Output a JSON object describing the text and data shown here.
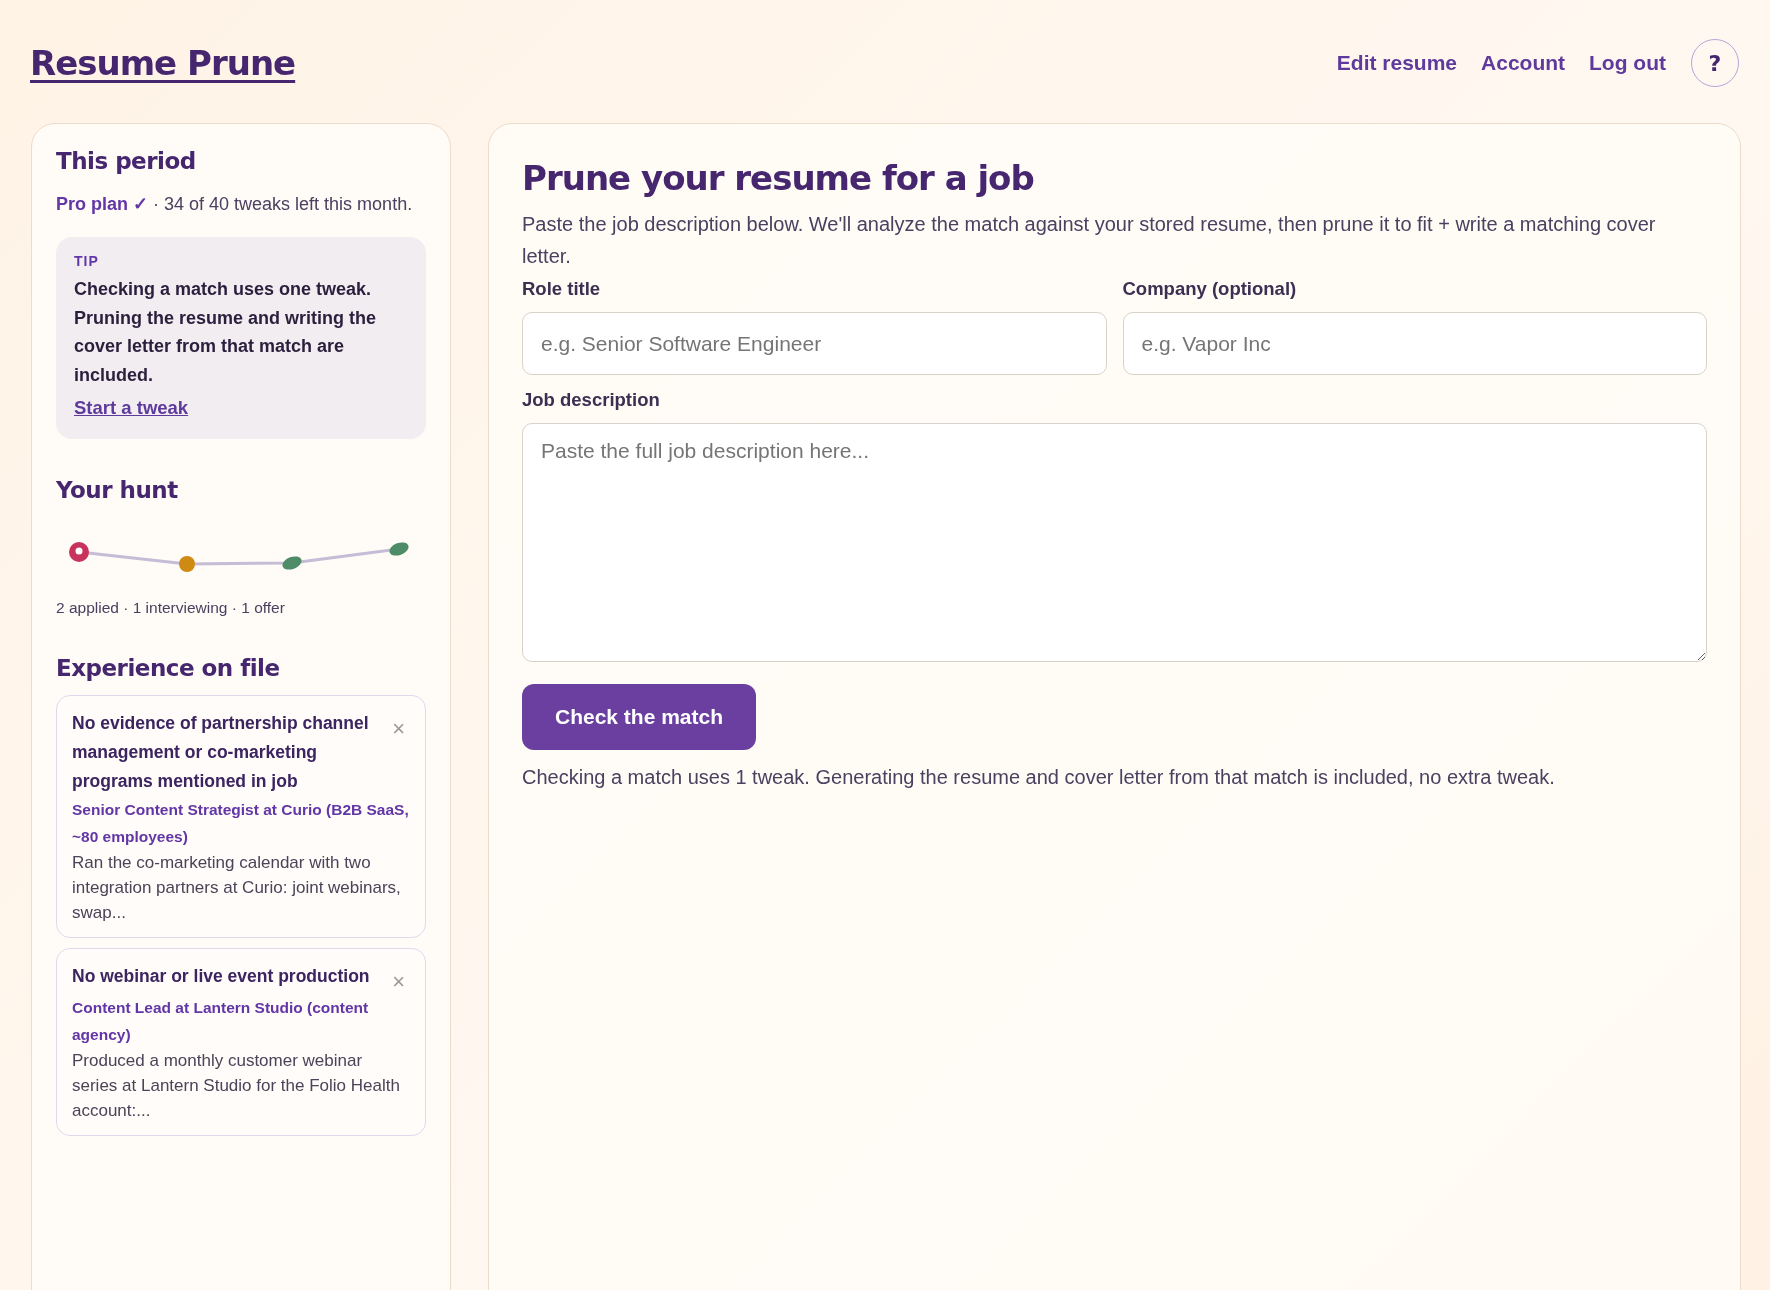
{
  "header": {
    "logo": "Resume Prune",
    "nav": [
      "Edit resume",
      "Account",
      "Log out"
    ],
    "help": "?"
  },
  "sidebar": {
    "period": {
      "heading": "This period",
      "status": "**Pro plan ✓** · 34 of 40 tweaks left this month."
    },
    "tip": {
      "label": "TIP",
      "text": "Checking a match uses one tweak. Pruning the resume and writing the cover letter from that match are included.",
      "link": "Start a tweak"
    },
    "hunt": {
      "heading": "Your hunt",
      "summary": "2 applied · 1 interviewing · 1 offer"
    },
    "experience": {
      "heading": "Experience on file",
      "items": [
        {
          "gap": "No evidence of partnership channel management or co-marketing programs mentioned in job",
          "role": "Senior Content Strategist at Curio (B2B SaaS, ~80 employees)",
          "excerpt": "Ran the co-marketing calendar with two integration partners at Curio: joint webinars, swap...",
          "remove": "×"
        },
        {
          "gap": "No webinar or live event production",
          "role": "Content Lead at Lantern Studio (content agency)",
          "excerpt": "Produced a monthly customer webinar series at Lantern Studio for the Folio Health account:...",
          "remove": "×"
        }
      ]
    }
  },
  "main": {
    "title": "Prune your resume for a job",
    "intro": "Paste the job description below. We'll analyze the match against your stored resume, then prune it to fit + write a matching cover letter.",
    "fields": [
      {
        "label": "Role title",
        "placeholder": "e.g. Senior Software Engineer"
      },
      {
        "label": "Company (optional)",
        "placeholder": "e.g. Vapor Inc"
      }
    ],
    "description": {
      "label": "Job description",
      "placeholder": "Paste the full job description here..."
    },
    "button": "Check the match",
    "note": "Checking a match uses 1 tweak. Generating the resume and cover letter from that match is included, no extra tweak."
  }
}
